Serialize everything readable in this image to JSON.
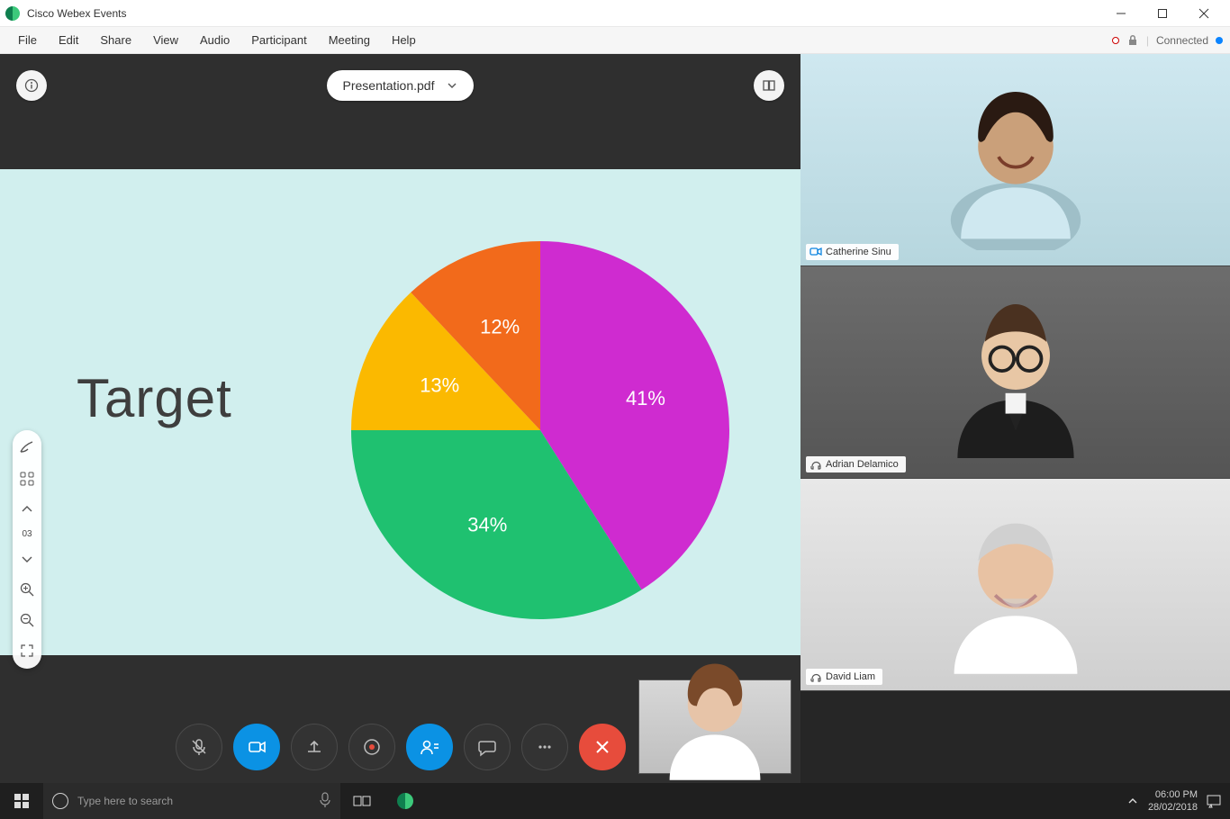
{
  "window": {
    "title": "Cisco Webex Events"
  },
  "menu": {
    "items": [
      "File",
      "Edit",
      "Share",
      "View",
      "Audio",
      "Participant",
      "Meeting",
      "Help"
    ],
    "status": "Connected"
  },
  "stage": {
    "fileName": "Presentation.pdf",
    "slideTitle": "Target",
    "pageNumber": "03"
  },
  "participants": [
    {
      "name": "Catherine Sinu",
      "cameraBadge": true
    },
    {
      "name": "Adrian Delamico",
      "cameraBadge": false
    },
    {
      "name": "David Liam",
      "cameraBadge": false
    }
  ],
  "taskbar": {
    "searchPlaceholder": "Type here to search",
    "time": "06:00 PM",
    "date": "28/02/2018"
  },
  "chart_data": {
    "type": "pie",
    "title": "Target",
    "series": [
      {
        "label": "41%",
        "value": 41,
        "color": "#cf2bd0"
      },
      {
        "label": "34%",
        "value": 34,
        "color": "#1fc170"
      },
      {
        "label": "13%",
        "value": 13,
        "color": "#fbb900"
      },
      {
        "label": "12%",
        "value": 12,
        "color": "#f26a1b"
      }
    ]
  }
}
